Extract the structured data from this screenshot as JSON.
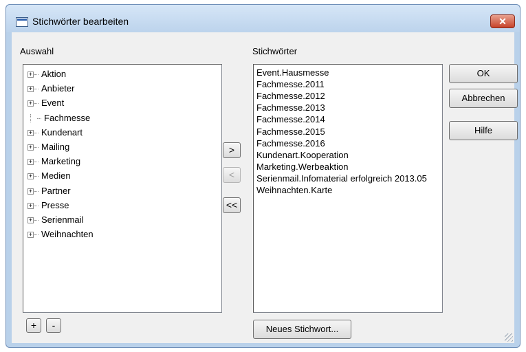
{
  "window": {
    "title": "Stichwörter bearbeiten",
    "close_glyph": "✕"
  },
  "left": {
    "label": "Auswahl",
    "items": [
      {
        "text": "Aktion",
        "expandable": true
      },
      {
        "text": "Anbieter",
        "expandable": true
      },
      {
        "text": "Event",
        "expandable": true
      },
      {
        "text": "Fachmesse",
        "expandable": false
      },
      {
        "text": "Kundenart",
        "expandable": true
      },
      {
        "text": "Mailing",
        "expandable": true
      },
      {
        "text": "Marketing",
        "expandable": true
      },
      {
        "text": "Medien",
        "expandable": true
      },
      {
        "text": "Partner",
        "expandable": true
      },
      {
        "text": "Presse",
        "expandable": true
      },
      {
        "text": "Serienmail",
        "expandable": true
      },
      {
        "text": "Weihnachten",
        "expandable": true
      }
    ],
    "add_label": "+",
    "remove_label": "-"
  },
  "middle": {
    "add_label": ">",
    "remove_label": "<",
    "remove_all_label": "<<"
  },
  "right": {
    "label": "Stichwörter",
    "items": [
      "Event.Hausmesse",
      "Fachmesse.2011",
      "Fachmesse.2012",
      "Fachmesse.2013",
      "Fachmesse.2014",
      "Fachmesse.2015",
      "Fachmesse.2016",
      "Kundenart.Kooperation",
      "Marketing.Werbeaktion",
      "Serienmail.Infomaterial erfolgreich 2013.05",
      "Weihnachten.Karte"
    ],
    "new_keyword_label": "Neues Stichwort..."
  },
  "buttons": {
    "ok": "OK",
    "cancel": "Abbrechen",
    "help": "Hilfe"
  },
  "icons": {
    "expand": "+"
  }
}
